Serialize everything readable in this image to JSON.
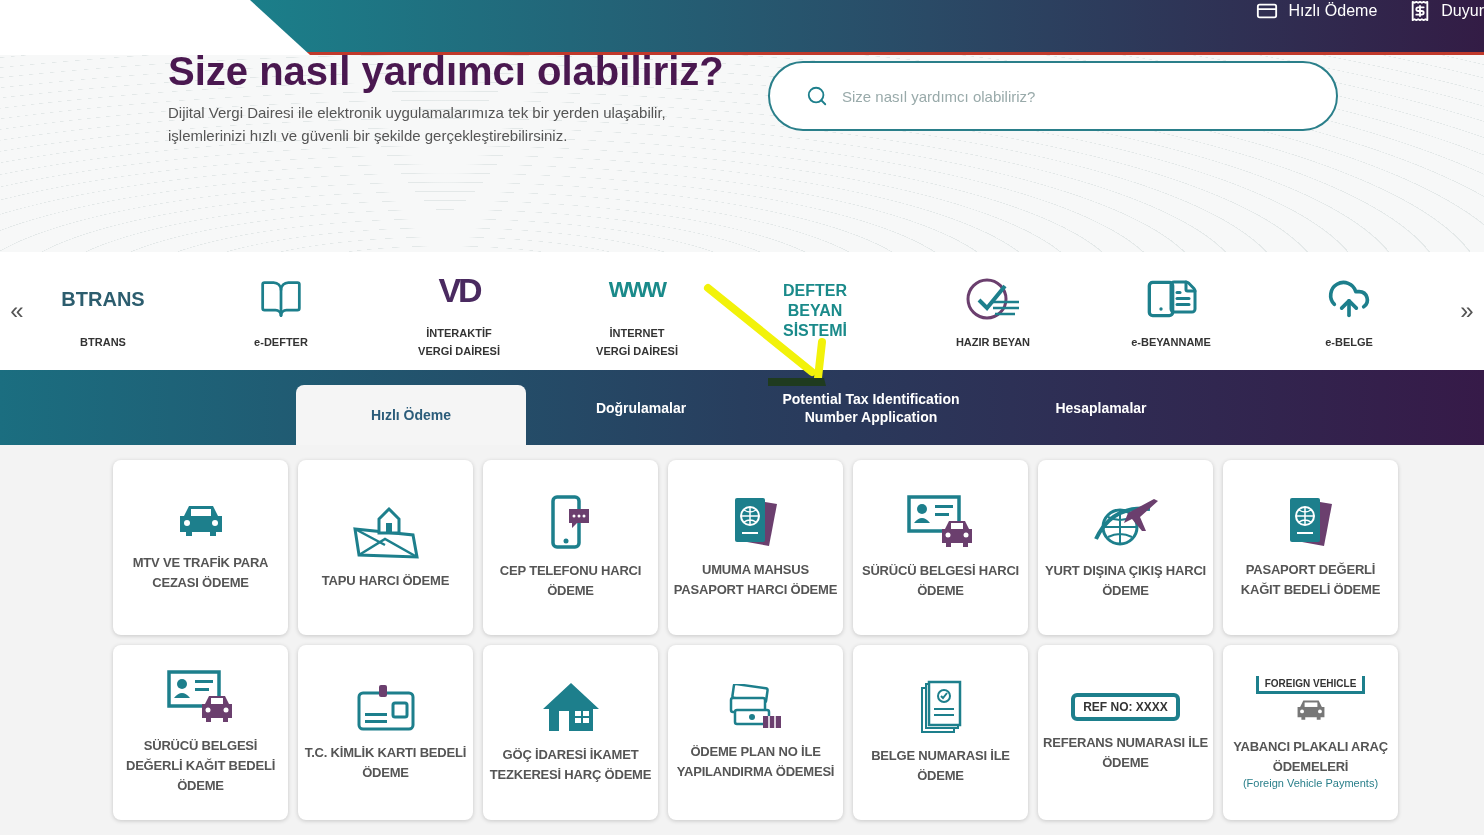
{
  "header": {
    "links": [
      {
        "label": "Hızlı Ödeme",
        "kind": "card"
      },
      {
        "label": "Duyur",
        "kind": "list"
      }
    ]
  },
  "hero": {
    "title": "Size nasıl yardımcı olabiliriz?",
    "subtitle_lines": [
      "Dijital Vergi Dairesi ile elektronik uygulamalarımıza tek bir yerden ulaşabilir,",
      "işlemlerinizi hızlı ve güvenli bir şekilde gerçekleştirebilirsiniz."
    ],
    "search": {
      "placeholder": "Size nasıl yardımcı olabiliriz?"
    }
  },
  "carousel": {
    "prev": "«",
    "next": "»",
    "items": [
      {
        "kind": "wordmark",
        "logo_text": "BTRANS",
        "label_lines": [
          "BTRANS"
        ]
      },
      {
        "kind": "book",
        "label_lines": [
          "e-DEFTER"
        ]
      },
      {
        "kind": "vd",
        "logo_text": "VD",
        "label_lines": [
          "İNTERAKTİF",
          "VERGİ DAİRESİ"
        ]
      },
      {
        "kind": "www",
        "logo_text": "WWW",
        "label_lines": [
          "İNTERNET",
          "VERGİ DAİRESİ"
        ]
      },
      {
        "kind": "stack",
        "logo_lines": [
          "DEFTER",
          "BEYAN",
          "SİSTEMİ"
        ]
      },
      {
        "kind": "check",
        "label_lines": [
          "HAZIR BEYAN"
        ]
      },
      {
        "kind": "phone",
        "label_lines": [
          "e-BEYANNAME"
        ]
      },
      {
        "kind": "cloud",
        "label_lines": [
          "e-BELGE"
        ]
      }
    ]
  },
  "tabs": [
    {
      "label_lines": [
        "Hızlı Ödeme"
      ],
      "selected": true
    },
    {
      "label_lines": [
        "Doğrulamalar"
      ],
      "selected": false
    },
    {
      "label_lines": [
        "Potential Tax Identification",
        "Number Application"
      ],
      "selected": false
    },
    {
      "label_lines": [
        "Hesaplamalar"
      ],
      "selected": false
    }
  ],
  "cards": [
    {
      "title": "MTV VE TRAFİK PARA CEZASI ÖDEME"
    },
    {
      "title": "TAPU HARCI ÖDEME"
    },
    {
      "title": "CEP TELEFONU HARCI ÖDEME"
    },
    {
      "title": "UMUMA MAHSUS PASAPORT HARCI ÖDEME"
    },
    {
      "title": "SÜRÜCÜ BELGESİ HARCI ÖDEME"
    },
    {
      "title": "YURT DIŞINA ÇIKIŞ HARCI ÖDEME"
    },
    {
      "title": "PASAPORT DEĞERLİ KAĞIT BEDELİ ÖDEME"
    },
    {
      "title": "SÜRÜCÜ BELGESİ DEĞERLİ KAĞIT BEDELİ ÖDEME"
    },
    {
      "title": "T.C. KİMLİK KARTI BEDELİ ÖDEME"
    },
    {
      "title": "GÖÇ İDARESİ İKAMET TEZKERESİ HARÇ ÖDEME"
    },
    {
      "title": "ÖDEME PLAN NO İLE YAPILANDIRMA ÖDEMESİ"
    },
    {
      "title": "BELGE NUMARASI İLE ÖDEME"
    },
    {
      "tag": "REF NO: XXXX",
      "title": "REFERANS NUMARASI İLE ÖDEME"
    },
    {
      "tag": "FOREIGN VEHICLE",
      "title": "YABANCI PLAKALI ARAÇ ÖDEMELERİ",
      "subtitle": "(Foreign Vehicle Payments)"
    }
  ]
}
